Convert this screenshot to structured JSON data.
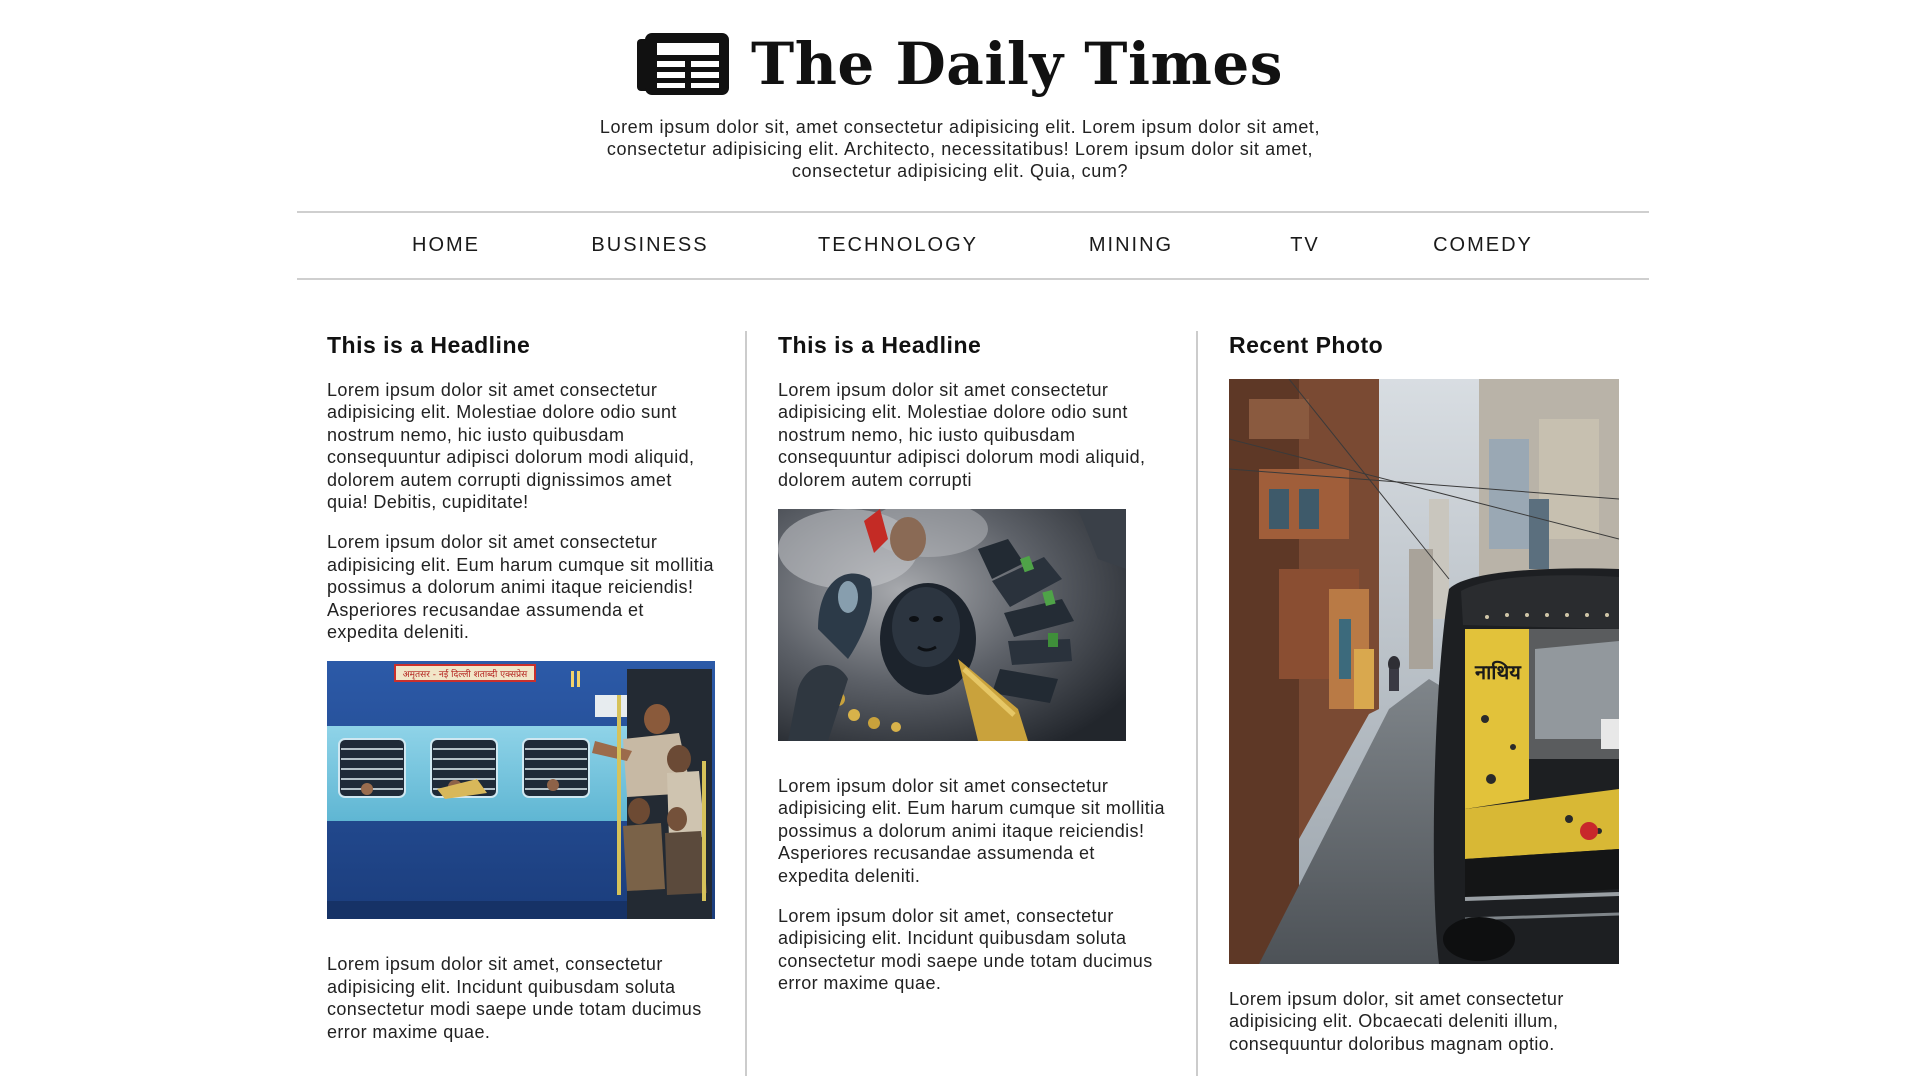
{
  "masthead": {
    "logo_icon": "newspaper-icon",
    "title": "The Daily Times",
    "tagline": "Lorem ipsum dolor sit, amet consectetur adipisicing elit. Lorem ipsum dolor sit amet, consectetur adipisicing elit. Architecto, necessitatibus! Lorem ipsum dolor sit amet, consectetur adipisicing elit. Quia, cum?"
  },
  "nav": {
    "items": [
      {
        "label": "HOME"
      },
      {
        "label": "BUSINESS"
      },
      {
        "label": "TECHNOLOGY"
      },
      {
        "label": "MINING"
      },
      {
        "label": "TV"
      },
      {
        "label": "COMEDY"
      }
    ]
  },
  "columns": [
    {
      "headline": "This is a Headline",
      "paragraphs": [
        "Lorem ipsum dolor sit amet consectetur adipisicing elit. Molestiae dolore odio sunt nostrum nemo, hic iusto quibusdam consequuntur adipisci dolorum modi aliquid, dolorem autem corrupti dignissimos amet quia! Debitis, cupiditate!",
        "Lorem ipsum dolor sit amet consectetur adipisicing elit. Eum harum cumque sit mollitia possimus a dolorum animi itaque reiciendis! Asperiores recusandae assumenda et expedita deleniti.",
        "Lorem ipsum dolor sit amet, consectetur adipisicing elit. Incidunt quibusdam soluta consectetur modi saepe unde totam ducimus error maxime quae."
      ],
      "photo_sign_text": "अमृतसर - नई दिल्ली शताब्दी एक्सप्रेस"
    },
    {
      "headline": "This is a Headline",
      "paragraphs": [
        "Lorem ipsum dolor sit amet consectetur adipisicing elit. Molestiae dolore odio sunt nostrum nemo, hic iusto quibusdam consequuntur adipisci dolorum modi aliquid, dolorem autem corrupti",
        "Lorem ipsum dolor sit amet consectetur adipisicing elit. Eum harum cumque sit mollitia possimus a dolorum animi itaque reiciendis! Asperiores recusandae assumenda et expedita deleniti.",
        "Lorem ipsum dolor sit amet, consectetur adipisicing elit. Incidunt quibusdam soluta consectetur modi saepe unde totam ducimus error maxime quae."
      ]
    },
    {
      "headline": "Recent Photo",
      "paragraphs": [
        "Lorem ipsum dolor, sit amet consectetur adipisicing elit. Obcaecati deleniti illum, consequuntur doloribus magnam optio."
      ],
      "photo_sign_text": "नाथिय"
    }
  ],
  "colors": {
    "text": "#222222",
    "rule": "#cccccc",
    "background": "#ffffff"
  }
}
